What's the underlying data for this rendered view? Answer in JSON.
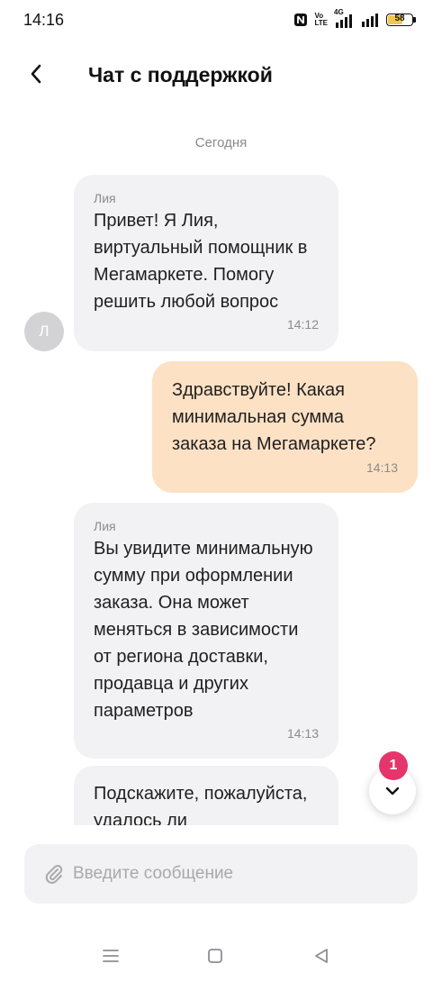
{
  "status_bar": {
    "time": "14:16",
    "volte_top": "Vo",
    "volte_bottom": "LTE",
    "network": "4G",
    "battery": "58"
  },
  "header": {
    "title": "Чат с поддержкой",
    "back_icon": "chevron-left-icon"
  },
  "chat": {
    "date_separator": "Сегодня",
    "messages": [
      {
        "direction": "incoming",
        "sender": "Лия",
        "text": "Привет! Я Лия, виртуальный помощник в Мегамаркете. Помогу решить любой вопрос",
        "time": "14:12",
        "avatar_letter": "Л"
      },
      {
        "direction": "outgoing",
        "text": "Здравствуйте! Какая минимальная сумма заказа на Мегамаркете?",
        "time": "14:13"
      },
      {
        "direction": "incoming",
        "sender": "Лия",
        "text": "Вы увидите минимальную сумму при оформлении заказа. Она может меняться в зависимости от региона доставки, продавца и других параметров",
        "time": "14:13"
      },
      {
        "direction": "incoming",
        "text": "Подскажите, пожалуйста, удалось ли"
      }
    ]
  },
  "scroll_button": {
    "unread_count": "1",
    "icon": "chevron-down-icon"
  },
  "input": {
    "placeholder": "Введите сообщение",
    "value": "",
    "attach_icon": "paperclip-icon"
  },
  "nav": {
    "icons": [
      "menu-icon",
      "home-square-icon",
      "back-triangle-icon"
    ]
  },
  "colors": {
    "incoming_bubble": "#f2f2f4",
    "outgoing_bubble": "#fde1c4",
    "badge": "#e5366b",
    "battery": "#f2c84b"
  }
}
